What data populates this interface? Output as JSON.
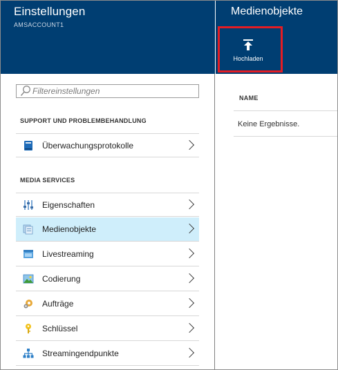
{
  "left_blade": {
    "title": "Einstellungen",
    "subtitle": "AMSACCOUNT1",
    "filter_placeholder": "Filtereinstellungen",
    "sections": [
      {
        "header": "SUPPORT UND PROBLEMBEHANDLUNG",
        "items": [
          {
            "label": "Überwachungsprotokolle",
            "icon": "log-book-icon"
          }
        ]
      },
      {
        "header": "MEDIA SERVICES",
        "items": [
          {
            "label": "Eigenschaften",
            "icon": "sliders-icon"
          },
          {
            "label": "Medienobjekte",
            "icon": "assets-icon",
            "selected": true
          },
          {
            "label": "Livestreaming",
            "icon": "live-stream-icon"
          },
          {
            "label": "Codierung",
            "icon": "encoding-image-icon"
          },
          {
            "label": "Aufträge",
            "icon": "jobs-gear-icon"
          },
          {
            "label": "Schlüssel",
            "icon": "key-icon"
          },
          {
            "label": "Streamingendpunkte",
            "icon": "endpoints-hierarchy-icon"
          }
        ]
      }
    ]
  },
  "right_blade": {
    "title": "Medienobjekte",
    "upload_label": "Hochladen",
    "column_header": "NAME",
    "empty_text": "Keine Ergebnisse."
  },
  "colors": {
    "header_bg": "#003e72",
    "selected_bg": "#cfeefb",
    "highlight_border": "#e51c23"
  }
}
